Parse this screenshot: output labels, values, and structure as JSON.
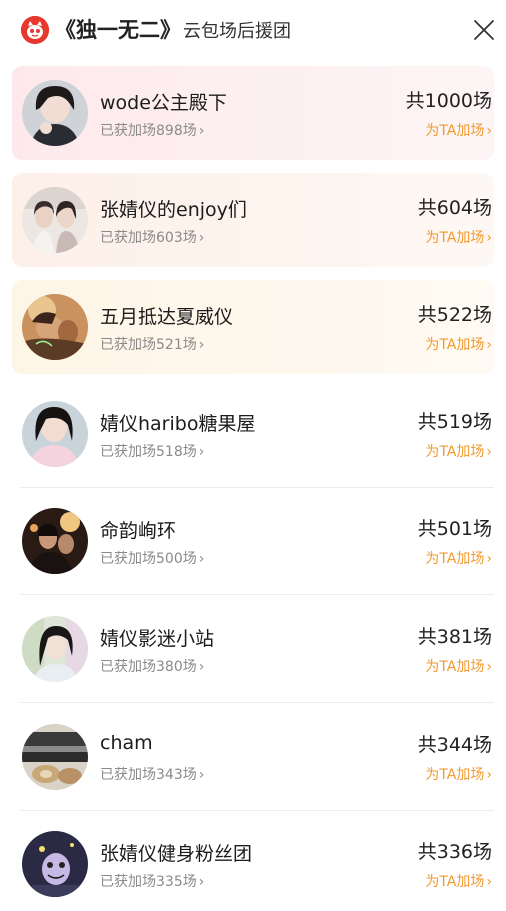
{
  "header": {
    "title_main": "《独一无二》",
    "title_sub": "云包场后援团",
    "logo_icon": "cat-logo-icon",
    "close_icon": "close-icon"
  },
  "colors": {
    "accent": "#f29a2e",
    "logo": "#e8372c",
    "muted_text": "#8a8a8a"
  },
  "rows": [
    {
      "name": "wode公主殿下",
      "got": "已获加场898场",
      "total": "共1000场",
      "action": "为TA加场"
    },
    {
      "name": "张婧仪的enjoy们",
      "got": "已获加场603场",
      "total": "共604场",
      "action": "为TA加场"
    },
    {
      "name": "五月抵达夏威仪",
      "got": "已获加场521场",
      "total": "共522场",
      "action": "为TA加场"
    },
    {
      "name": "婧仪haribo糖果屋",
      "got": "已获加场518场",
      "total": "共519场",
      "action": "为TA加场"
    },
    {
      "name": "命韵峋环",
      "got": "已获加场500场",
      "total": "共501场",
      "action": "为TA加场"
    },
    {
      "name": "婧仪影迷小站",
      "got": "已获加场380场",
      "total": "共381场",
      "action": "为TA加场"
    },
    {
      "name": "cham",
      "got": "已获加场343场",
      "total": "共344场",
      "action": "为TA加场"
    },
    {
      "name": "张婧仪健身粉丝团",
      "got": "已获加场335场",
      "total": "共336场",
      "action": "为TA加场"
    }
  ]
}
